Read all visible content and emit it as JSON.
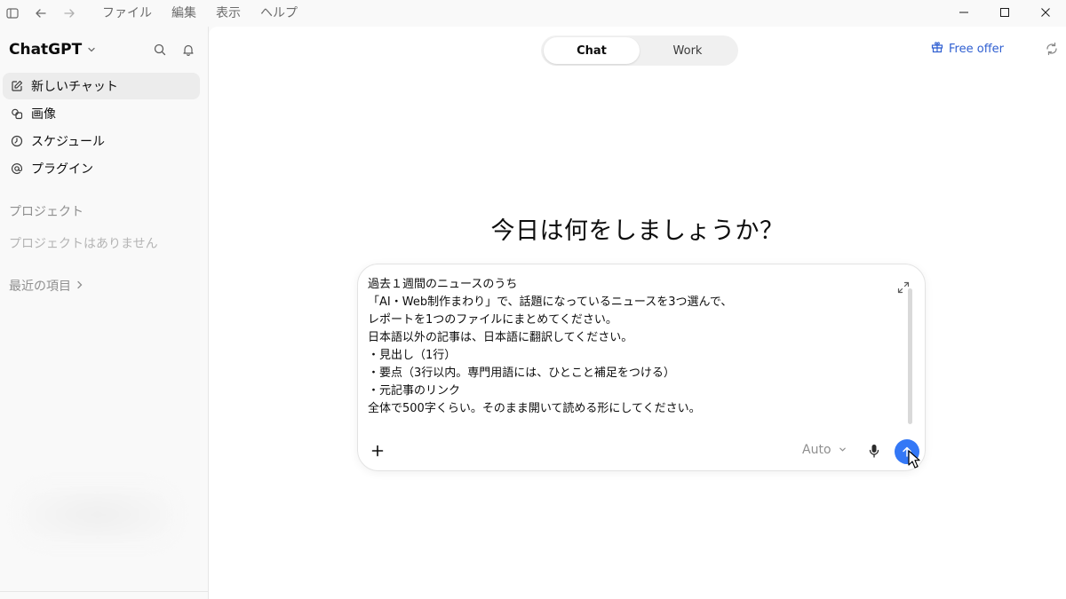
{
  "menu": {
    "items": [
      "ファイル",
      "編集",
      "表示",
      "ヘルプ"
    ]
  },
  "sidebar": {
    "brand": "ChatGPT",
    "nav": [
      {
        "label": "新しいチャット",
        "icon": "edit-icon"
      },
      {
        "label": "画像",
        "icon": "image-icon"
      },
      {
        "label": "スケジュール",
        "icon": "clock-icon"
      },
      {
        "label": "プラグイン",
        "icon": "at-icon"
      }
    ],
    "projects_title": "プロジェクト",
    "projects_empty": "プロジェクトはありません",
    "recent_label": "最近の項目"
  },
  "header": {
    "toggle": {
      "chat": "Chat",
      "work": "Work",
      "selected": "Chat"
    },
    "free_offer": "Free offer"
  },
  "main": {
    "headline": "今日は何をしましょうか？"
  },
  "composer": {
    "text": "過去１週間のニュースのうち\n「AI・Web制作まわり」で、話題になっているニュースを3つ選んで、\nレポートを1つのファイルにまとめてください。\n日本語以外の記事は、日本語に翻訳してください。\n・見出し（1行）\n・要点（3行以内。専門用語には、ひとこと補足をつける）\n・元記事のリンク\n全体で500字くらい。そのまま開いて読める形にしてください。",
    "model": "Auto"
  },
  "colors": {
    "accent": "#3478f6",
    "link": "#2f5fd1",
    "sidebar_bg": "#f9f9f9",
    "main_bg": "#ffffff"
  }
}
